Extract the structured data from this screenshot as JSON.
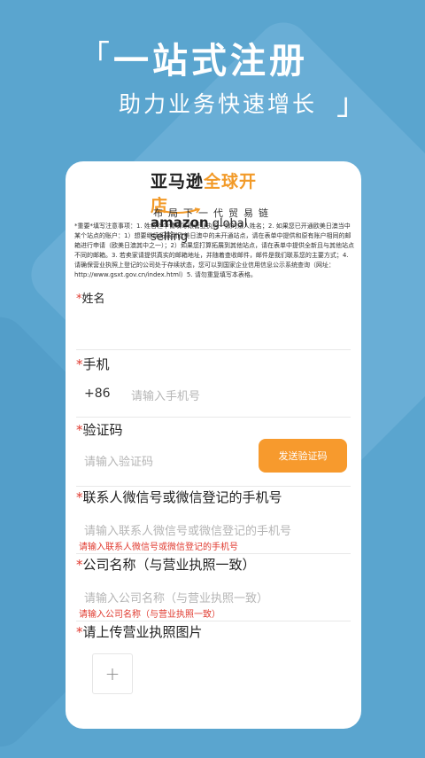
{
  "hero": {
    "open_quote": "「",
    "title": "一站式注册",
    "subtitle": "助力业务快速增长",
    "close_quote": "」"
  },
  "logo": {
    "cn_part1": "亚马逊",
    "cn_part2": "全球开店",
    "en_part1": "amazon",
    "en_part2": " global selling",
    "tagline": "布局下一代贸易链"
  },
  "notice": "*重要*填写注意事项：1. 姓名栏中请填写跟营业执照一致的法人姓名；2. 如果您已开通欧美日澳当中某个站点的账户：1）想要继续拓展到欧美日澳中的未开通站点，请在表单中提供和原有账户相同的邮箱进行申请（欧美日澳其中之一）；2）如果您打算拓展到其他站点，请在表单中提供全新且与其他站点不同的邮箱。3. 若卖家请提供真实的邮箱地址，并随着查收邮件，邮件是我们联系您的主要方式；4. 请确保营业执照上登记的公司处于存续状态，您可以到国家企业信用信息公示系统查询（网址：http://www.gsxt.gov.cn/index.html）5. 请勿重复填写本表格。",
  "form": {
    "name": {
      "star": "*",
      "label": "姓名"
    },
    "phone": {
      "star": "*",
      "label": "手机",
      "prefix": "+86",
      "placeholder": "请输入手机号"
    },
    "code": {
      "star": "*",
      "label": "验证码",
      "placeholder": "请输入验证码",
      "button": "发送验证码"
    },
    "wechat": {
      "star": "*",
      "label": "联系人微信号或微信登记的手机号",
      "placeholder": "请输入联系人微信号或微信登记的手机号",
      "error": "请输入联系人微信号或微信登记的手机号"
    },
    "company": {
      "star": "*",
      "label": "公司名称（与营业执照一致）",
      "placeholder": "请输入公司名称（与营业执照一致）",
      "error": "请输入公司名称（与营业执照一致）"
    },
    "license": {
      "star": "*",
      "label": "请上传营业执照图片",
      "upload_symbol": "+"
    }
  },
  "colors": {
    "background": "#5aa5cf",
    "accent": "#f79a2d",
    "error": "#e03a2f"
  }
}
